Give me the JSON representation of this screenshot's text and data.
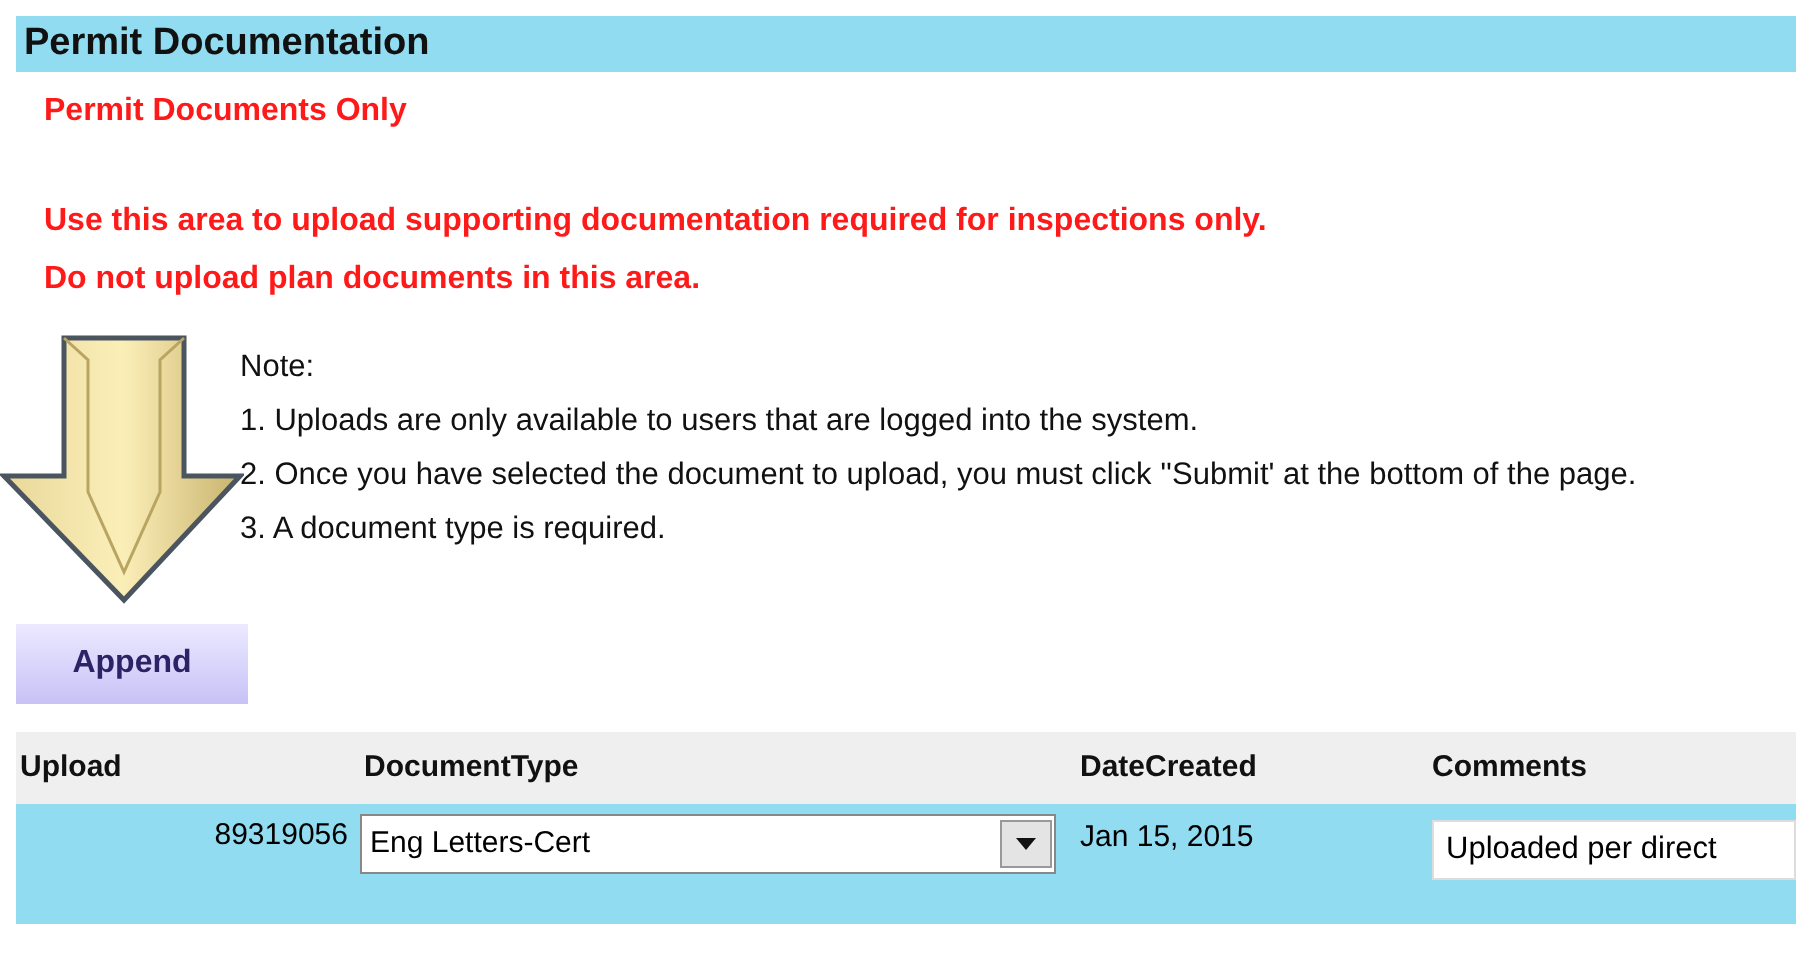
{
  "section": {
    "title": "Permit Documentation"
  },
  "warnings": [
    "Permit Documents Only",
    "Use this area to upload supporting documentation required for inspections only.",
    "Do not upload plan documents in this area."
  ],
  "note": {
    "heading": "Note:",
    "items": [
      "1. Uploads are only available to users that are logged into the system.",
      "2. Once you have selected the document to upload, you must click ''Submit' at the bottom of the page.",
      "3. A document type is required."
    ]
  },
  "append_button": "Append",
  "table": {
    "columns": [
      "Upload",
      "DocumentType",
      "DateCreated",
      "Comments"
    ],
    "rows": [
      {
        "upload": "89319056",
        "document_type": "Eng Letters-Cert",
        "date_created": "Jan 15, 2015",
        "comments": "Uploaded per direct"
      }
    ]
  }
}
